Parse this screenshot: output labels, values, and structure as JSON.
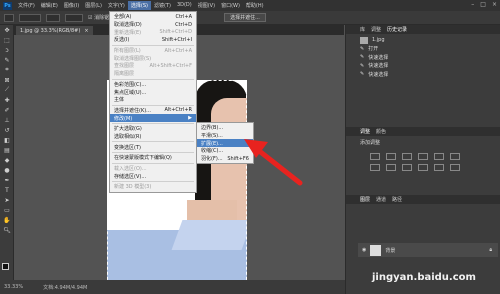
{
  "app": {
    "logo": "Ps"
  },
  "menubar": {
    "items": [
      "文件(F)",
      "编辑(E)",
      "图像(I)",
      "图层(L)",
      "文字(Y)",
      "选择(S)",
      "滤镜(T)",
      "3D(D)",
      "视图(V)",
      "窗口(W)",
      "帮助(H)"
    ],
    "active_index": 5
  },
  "optionsbar": {
    "anti_alias": "消除锯齿",
    "select_mask_button": "选择并遮住..."
  },
  "document": {
    "tab_label": "1.jpg @ 33.3%(RGB/8#)",
    "close": "×"
  },
  "statusbar": {
    "zoom": "33.33%",
    "doc_size": "文档:4.94M/4.94M"
  },
  "select_menu": {
    "items": [
      {
        "label": "全部(A)",
        "shortcut": "Ctrl+A"
      },
      {
        "label": "取消选择(D)",
        "shortcut": "Ctrl+D"
      },
      {
        "label": "重新选择(E)",
        "shortcut": "Shift+Ctrl+D",
        "disabled": true
      },
      {
        "label": "反选(I)",
        "shortcut": "Shift+Ctrl+I",
        "sep_after": true
      },
      {
        "label": "所有图层(L)",
        "shortcut": "Alt+Ctrl+A",
        "disabled": true
      },
      {
        "label": "取消选择图层(S)",
        "shortcut": "",
        "disabled": true
      },
      {
        "label": "查找图层",
        "shortcut": "Alt+Shift+Ctrl+F",
        "disabled": true
      },
      {
        "label": "隔离图层",
        "shortcut": "",
        "disabled": true,
        "sep_after": true
      },
      {
        "label": "色彩范围(C)...",
        "shortcut": ""
      },
      {
        "label": "焦点区域(U)...",
        "shortcut": ""
      },
      {
        "label": "主体",
        "shortcut": "",
        "sep_after": true
      },
      {
        "label": "选择并遮住(K)...",
        "shortcut": "Alt+Ctrl+R"
      },
      {
        "label": "修改(M)",
        "shortcut": "▶",
        "highlighted": true,
        "sep_after": true
      },
      {
        "label": "扩大选取(G)",
        "shortcut": ""
      },
      {
        "label": "选取相似(R)",
        "shortcut": "",
        "sep_after": true
      },
      {
        "label": "变换选区(T)",
        "shortcut": "",
        "sep_after": true
      },
      {
        "label": "在快速蒙版模式下编辑(Q)",
        "shortcut": "",
        "sep_after": true
      },
      {
        "label": "载入选区(O)...",
        "shortcut": "",
        "disabled": true
      },
      {
        "label": "存储选区(V)...",
        "shortcut": "",
        "sep_after": true
      },
      {
        "label": "新建 3D 模型(3)",
        "shortcut": "",
        "disabled": true
      }
    ]
  },
  "modify_submenu": {
    "items": [
      {
        "label": "边界(B)...",
        "shortcut": ""
      },
      {
        "label": "平滑(S)...",
        "shortcut": ""
      },
      {
        "label": "扩展(E)...",
        "shortcut": "",
        "highlighted": true
      },
      {
        "label": "收缩(C)...",
        "shortcut": ""
      },
      {
        "label": "羽化(F)...",
        "shortcut": "Shift+F6"
      }
    ]
  },
  "history_panel": {
    "tabs": [
      "库",
      "调整",
      "历史记录"
    ],
    "active_tab": 2,
    "snapshot": "1.jpg",
    "items": [
      "打开",
      "快速选择",
      "快速选择",
      "快速选择"
    ]
  },
  "adjust_panel": {
    "tabs": [
      "调整",
      "颜色"
    ],
    "title": "添加调整"
  },
  "layers_panel": {
    "tabs": [
      "图层",
      "通道",
      "路径"
    ],
    "layer_name": "背景"
  },
  "watermark": "jingyan.baidu.com"
}
